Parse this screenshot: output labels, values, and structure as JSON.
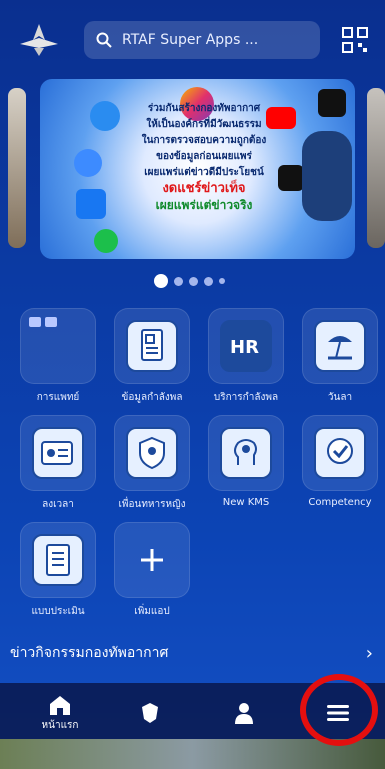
{
  "search": {
    "placeholder": "RTAF Super Apps ..."
  },
  "banner": {
    "lines": [
      "ร่วมกันสร้างกองทัพอากาศ",
      "ให้เป็นองค์กรที่มีวัฒนธรรม",
      "ในการตรวจสอบความถูกต้อง",
      "ของข้อมูลก่อนเผยแพร่",
      "เผยแพร่แต่ข่าวดีมีประโยชน์"
    ],
    "red_text": "งดแชร์ข่าวเท็จ",
    "green_text": "เผยแพร่แต่ข่าวจริง"
  },
  "carousel": {
    "dots": 5,
    "active_index": 0
  },
  "apps": [
    {
      "label": "การแพทย์"
    },
    {
      "label": "ข้อมูลกำลังพล"
    },
    {
      "label": "บริการกำลังพล"
    },
    {
      "label": "วันลา"
    },
    {
      "label": "ลงเวลา"
    },
    {
      "label": "เพื่อนทหารหญิง"
    },
    {
      "label": "New KMS"
    },
    {
      "label": "Competency"
    },
    {
      "label": "แบบประเมิน"
    },
    {
      "label": "เพิ่มแอป"
    }
  ],
  "news": {
    "title": "ข่าวกิจกรรมกองทัพอากาศ"
  },
  "nav": {
    "home_label": "หน้าแรก"
  },
  "colors": {
    "highlight": "#e40f0f",
    "accent": "#0b3aa3"
  }
}
